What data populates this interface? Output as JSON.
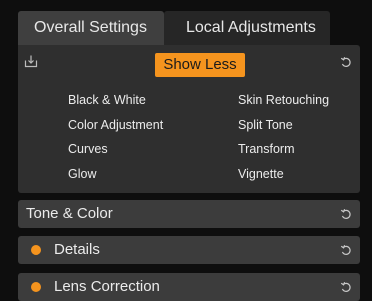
{
  "tabs": [
    {
      "label": "Overall Settings",
      "active": true
    },
    {
      "label": "Local Adjustments",
      "active": false
    }
  ],
  "tools_panel": {
    "export_icon": "export-icon",
    "reset_icon": "reset-undo-icon",
    "toggle_label": "Show Less",
    "items": [
      "Black & White",
      "Skin Retouching",
      "Color Adjustment",
      "Split Tone",
      "Curves",
      "Transform",
      "Glow",
      "Vignette"
    ]
  },
  "sections": [
    {
      "title": "Tone & Color",
      "modified": false
    },
    {
      "title": "Details",
      "modified": true
    },
    {
      "title": "Lens Correction",
      "modified": true
    }
  ],
  "colors": {
    "accent": "#f5941e",
    "panel": "#2f2f2f",
    "section": "#3c3c3c",
    "background": "#0e0e0e"
  }
}
